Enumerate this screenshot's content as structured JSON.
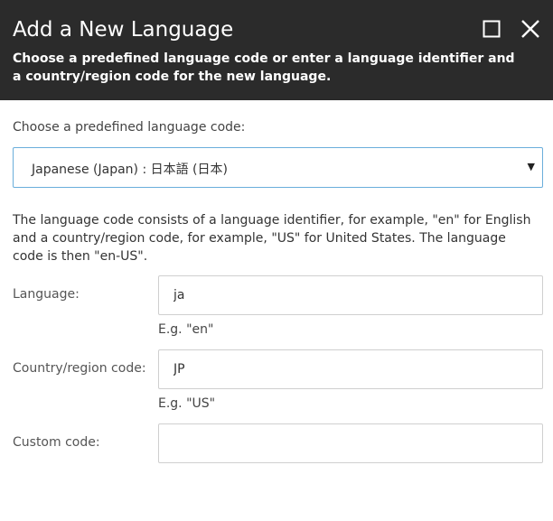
{
  "dialog": {
    "title": "Add a New Language",
    "description": "Choose a predefined language code or enter a language identifier and a country/region code for the new language.",
    "maximize_icon": "maximize-icon",
    "close_icon": "close-icon"
  },
  "predefined": {
    "label": "Choose a predefined language code:",
    "selected": "Japanese (Japan) : 日本語 (日本)",
    "caret": "▼"
  },
  "info": {
    "text": "The language code consists of a language identifier, for example, \"en\" for English and a country/region code, for example, \"US\" for United States. The language code is then \"en-US\"."
  },
  "fields": {
    "language": {
      "label": "Language:",
      "value": "ja",
      "hint": "E.g. \"en\""
    },
    "country": {
      "label": "Country/region code:",
      "value": "JP",
      "hint": "E.g. \"US\""
    },
    "custom": {
      "label": "Custom code:",
      "value": ""
    }
  }
}
